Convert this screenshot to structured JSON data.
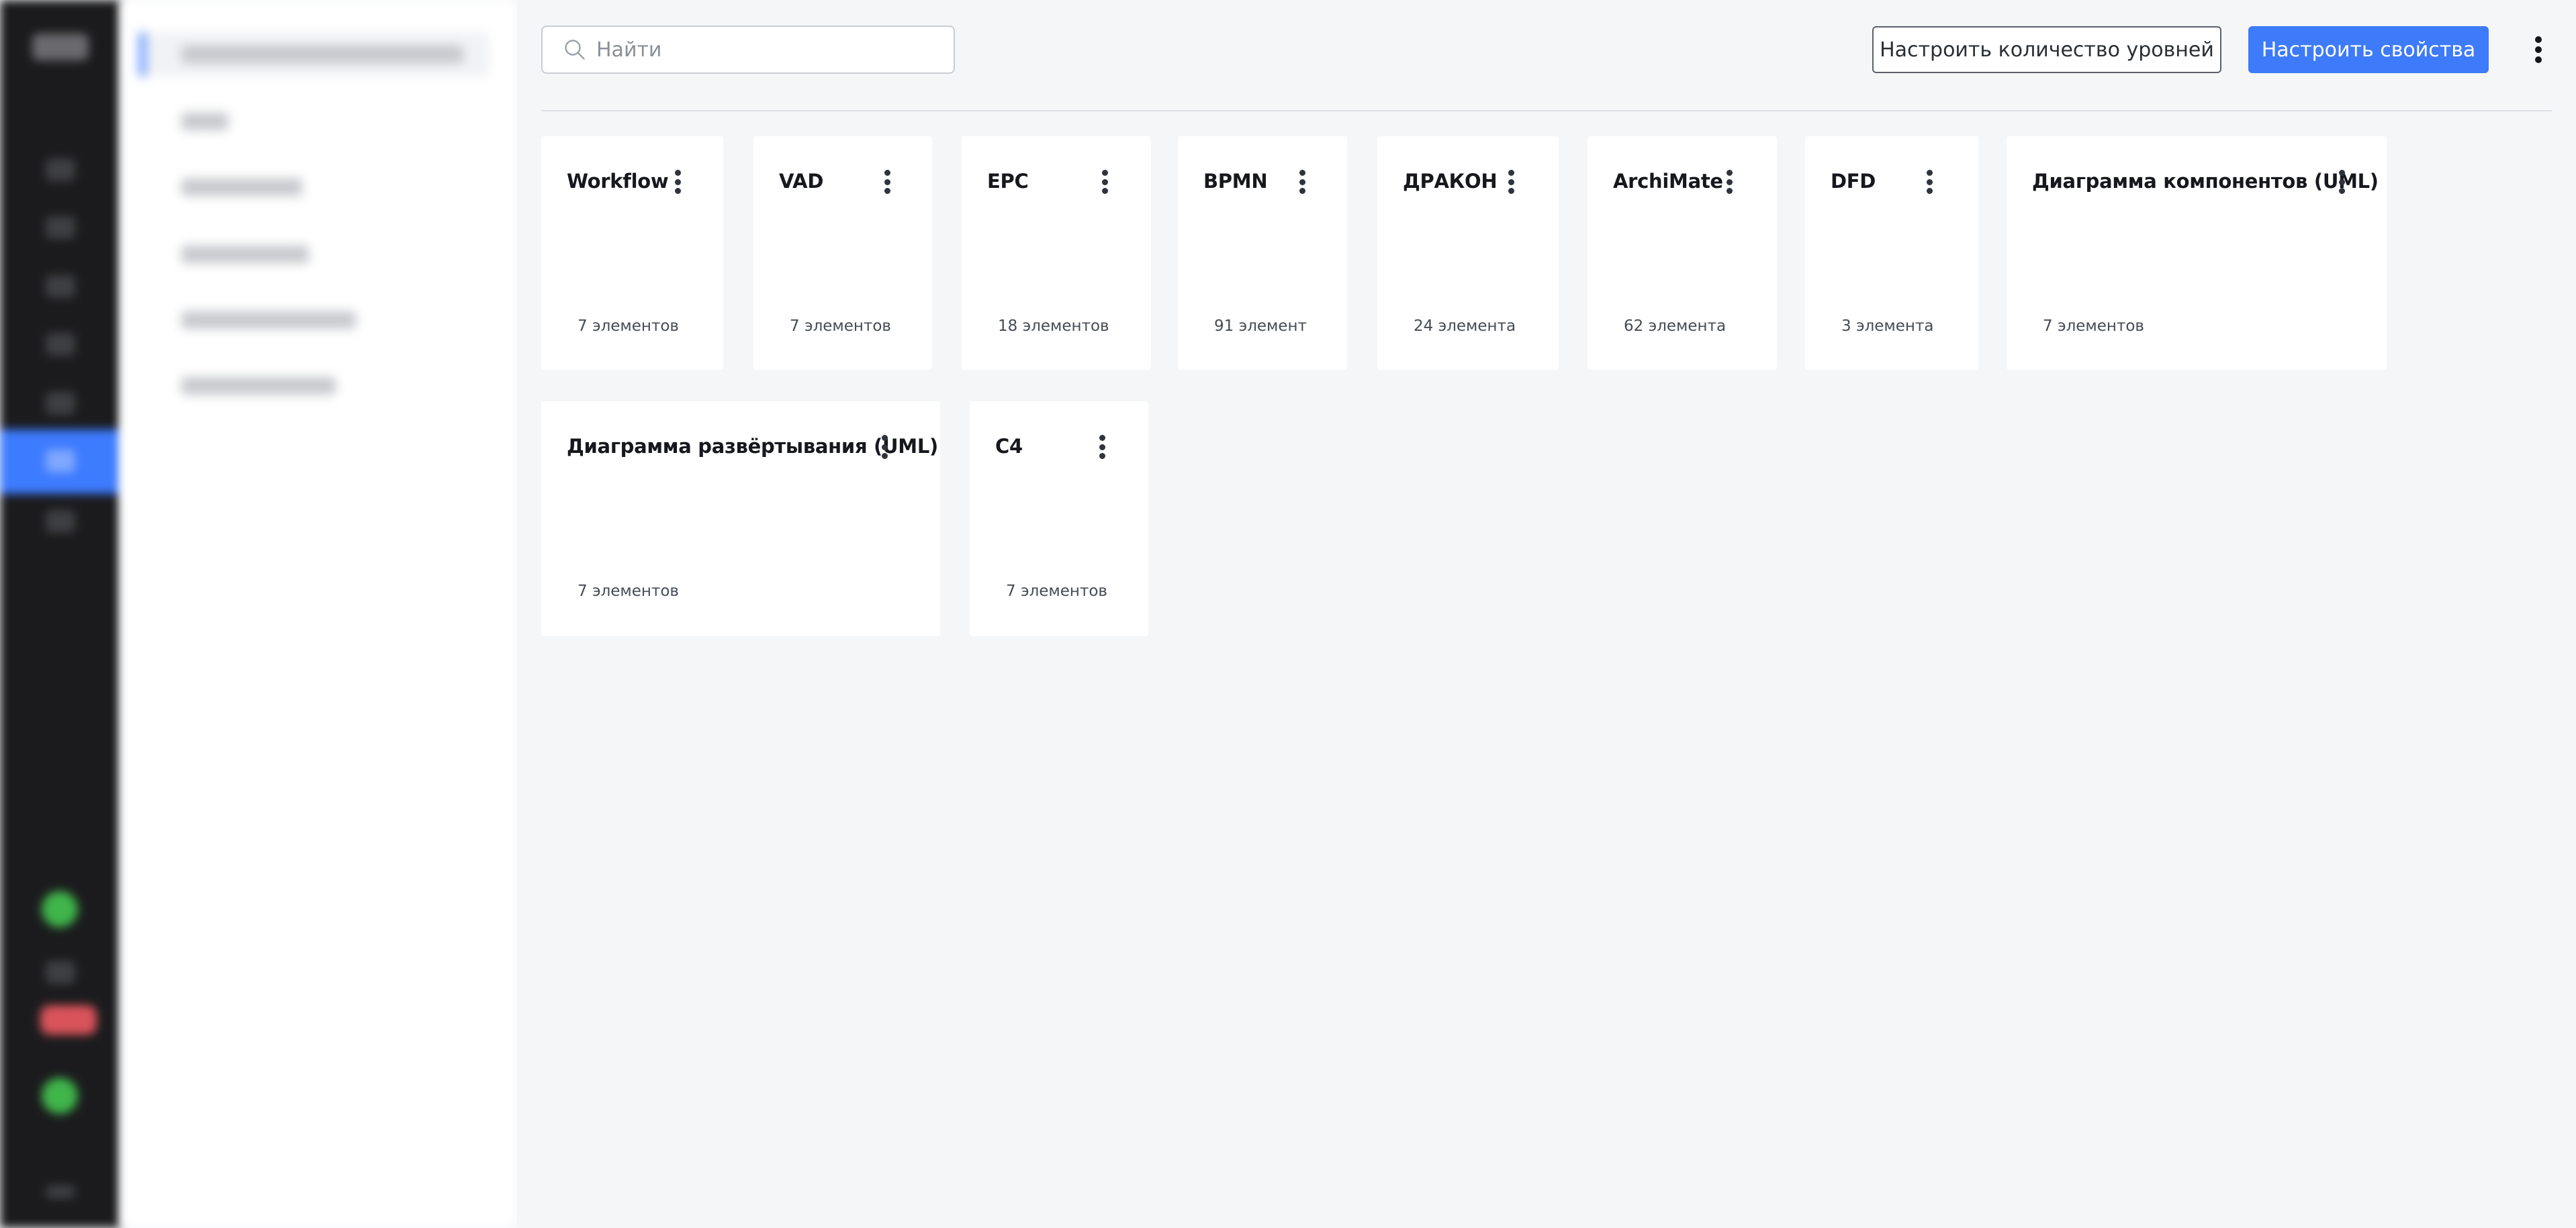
{
  "search": {
    "placeholder": "Найти",
    "value": ""
  },
  "toolbar": {
    "levels_button_label": "Настроить количество уровней",
    "properties_button_label": "Настроить свойства"
  },
  "colors": {
    "primary": "#3e7bfa",
    "background": "#f5f6f8",
    "card": "#ffffff"
  },
  "cards": [
    {
      "title": "Workflow",
      "count": "7 элементов"
    },
    {
      "title": "VAD",
      "count": "7 элементов"
    },
    {
      "title": "EPC",
      "count": "18 элементов"
    },
    {
      "title": "BPMN",
      "count": "91 элемент"
    },
    {
      "title": "ДРАКОН",
      "count": "24 элемента"
    },
    {
      "title": "ArchiMate",
      "count": "62 элемента"
    },
    {
      "title": "DFD",
      "count": "3 элемента"
    },
    {
      "title": "Диаграмма компонентов (UML)",
      "count": "7 элементов"
    },
    {
      "title": "Диаграмма развёртывания (UML)",
      "count": "7 элементов"
    },
    {
      "title": "C4",
      "count": "7 элементов"
    }
  ]
}
